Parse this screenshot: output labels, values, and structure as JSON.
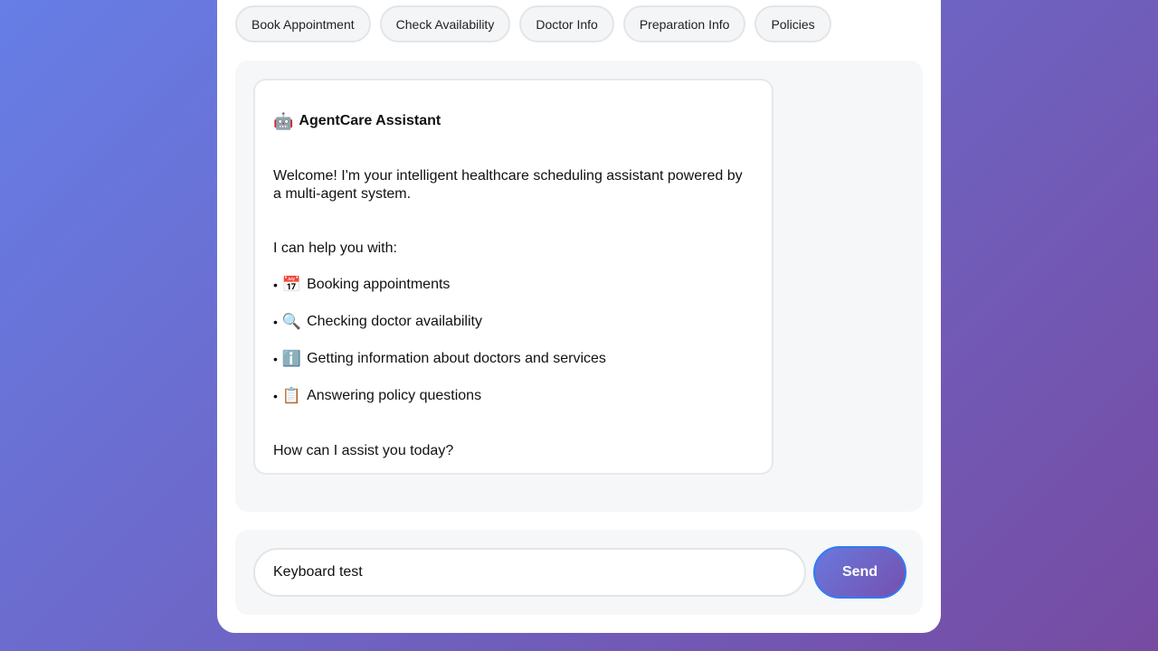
{
  "quick_actions": [
    {
      "label": "Book Appointment"
    },
    {
      "label": "Check Availability"
    },
    {
      "label": "Doctor Info"
    },
    {
      "label": "Preparation Info"
    },
    {
      "label": "Policies"
    }
  ],
  "chat": {
    "bot_message": {
      "icon": "🤖",
      "title": "AgentCare Assistant",
      "welcome": "Welcome! I'm your intelligent healthcare scheduling assistant powered by a multi-agent system.",
      "intro": "I can help you with:",
      "items": [
        {
          "bullet": "•",
          "icon": "📅",
          "icon_name": "calendar-icon",
          "text": "Booking appointments"
        },
        {
          "bullet": "•",
          "icon": "🔍",
          "icon_name": "magnifier-icon",
          "text": "Checking doctor availability"
        },
        {
          "bullet": "•",
          "icon": "ℹ️",
          "icon_name": "info-icon",
          "text": "Getting information about doctors and services"
        },
        {
          "bullet": "•",
          "icon": "📋",
          "icon_name": "clipboard-icon",
          "text": "Answering policy questions"
        }
      ],
      "closing": "How can I assist you today?"
    }
  },
  "input": {
    "value": "Keyboard test",
    "send_label": "Send"
  },
  "colors": {
    "background_start": "#667ee6",
    "background_end": "#764ba2",
    "send_border": "#2f7bf5"
  }
}
